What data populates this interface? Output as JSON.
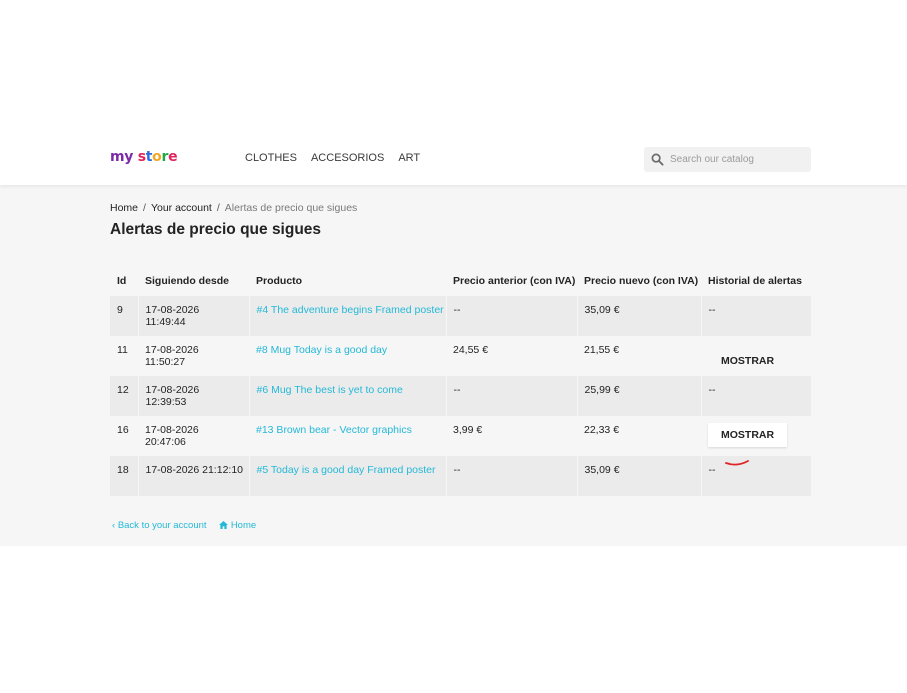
{
  "header": {
    "logo": {
      "parts": [
        "my",
        " ",
        "s",
        "t",
        "o",
        "r",
        "e"
      ]
    },
    "menu": [
      "CLOTHES",
      "ACCESORIOS",
      "ART"
    ],
    "search": {
      "placeholder": "Search our catalog"
    }
  },
  "breadcrumb": {
    "home": "Home",
    "sep1": "/",
    "account": "Your account",
    "sep2": "/",
    "current": "Alertas de precio que sigues"
  },
  "page_title": "Alertas de precio que sigues",
  "table": {
    "headers": {
      "id": "Id",
      "since": "Siguiendo desde",
      "product": "Producto",
      "prev": "Precio anterior (con IVA)",
      "new": "Precio nuevo (con IVA)",
      "history": "Historial de alertas"
    },
    "rows": [
      {
        "id": "9",
        "date": "17-08-2026",
        "time": "11:49:44",
        "product": "#4 The adventure begins Framed poster",
        "prev": "--",
        "new": "35,09 €",
        "history": "--"
      },
      {
        "id": "11",
        "date": "17-08-2026",
        "time": "11:50:27",
        "product": "#8 Mug Today is a good day",
        "prev": "24,55 €",
        "new": "21,55 €",
        "history": "MOSTRAR"
      },
      {
        "id": "12",
        "date": "17-08-2026",
        "time": "12:39:53",
        "product": "#6 Mug The best is yet to come",
        "prev": "--",
        "new": "25,99 €",
        "history": "--"
      },
      {
        "id": "16",
        "date": "17-08-2026",
        "time": "20:47:06",
        "product": "#13 Brown bear - Vector graphics",
        "prev": "3,99 €",
        "new": "22,33 €",
        "history": "MOSTRAR"
      },
      {
        "id": "18",
        "date": "17-08-2026 21:12:10",
        "time": "",
        "product": "#5 Today is a good day Framed poster",
        "prev": "--",
        "new": "35,09 €",
        "history": "--"
      }
    ]
  },
  "footer_links": {
    "back": "Back to your account",
    "home": "Home"
  },
  "colors": {
    "accent": "#24b9d7",
    "logo": [
      "#7b2aa8",
      "#e0245e",
      "#2d6cdf",
      "#f5a623",
      "#1ba94c",
      "#e0245e"
    ]
  }
}
